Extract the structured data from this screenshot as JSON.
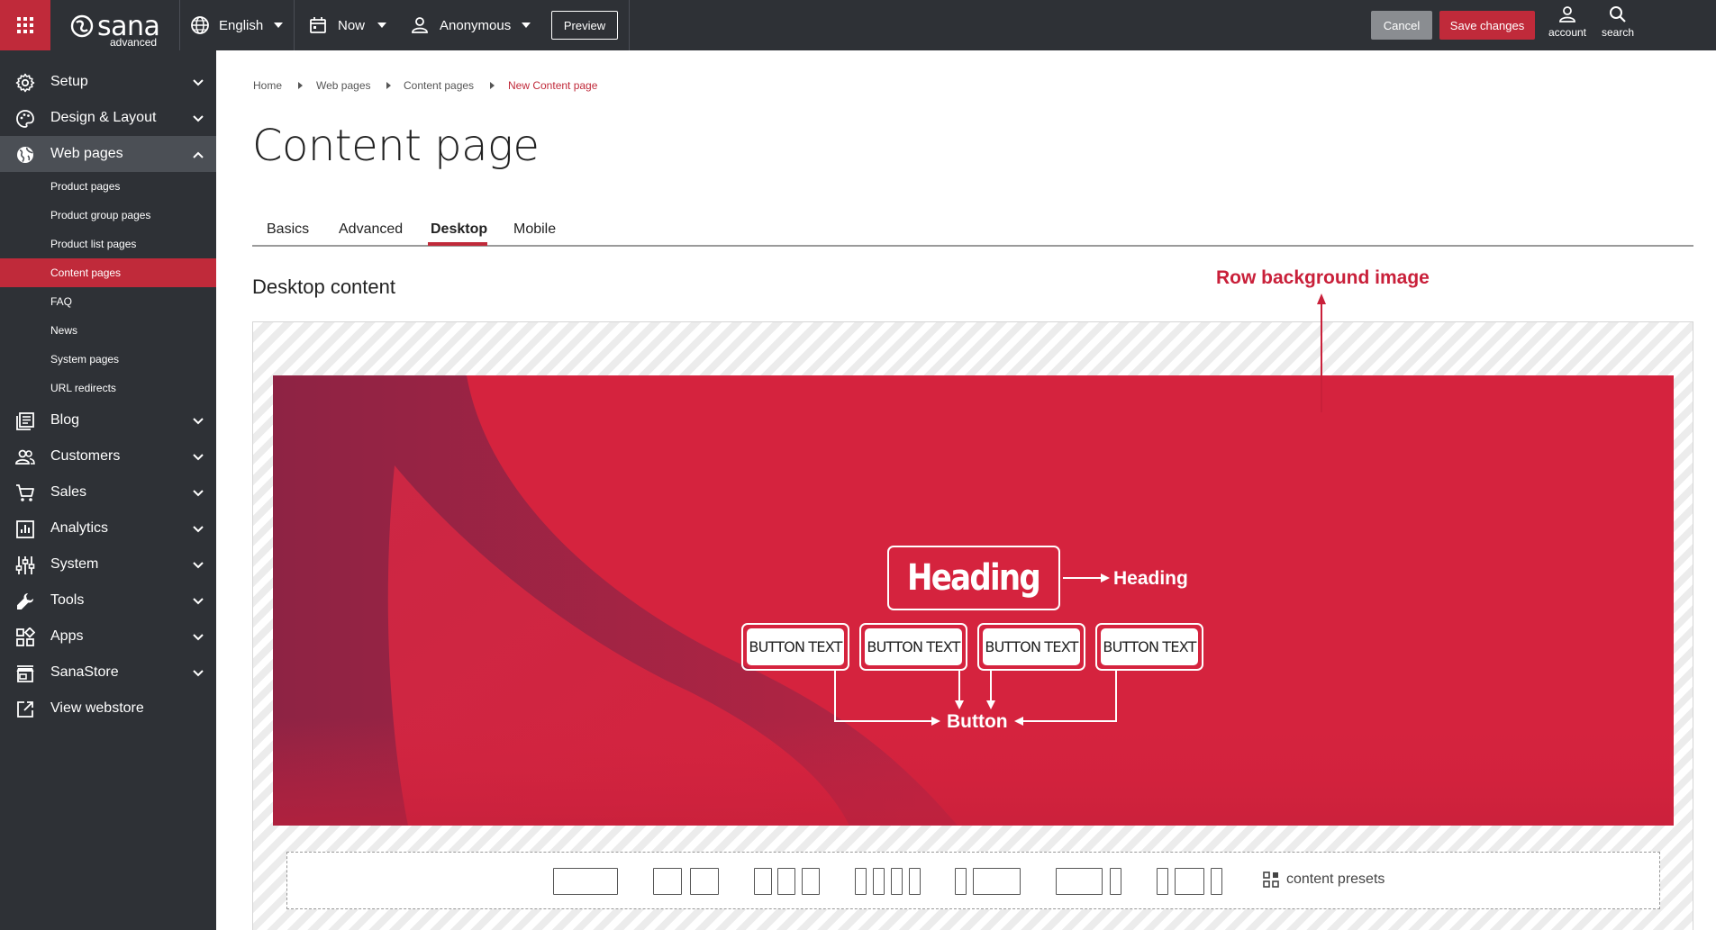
{
  "topbar": {
    "logo_text": "sana",
    "logo_sub": "advanced",
    "language": "English",
    "date": "Now",
    "user": "Anonymous",
    "preview_label": "Preview",
    "cancel_label": "Cancel",
    "save_label": "Save changes",
    "account_label": "account",
    "search_label": "search"
  },
  "sidebar": {
    "items": [
      {
        "label": "Setup",
        "icon": "gear-icon"
      },
      {
        "label": "Design & Layout",
        "icon": "palette-icon"
      },
      {
        "label": "Web pages",
        "icon": "globe-icon",
        "expanded": true
      },
      {
        "label": "Blog",
        "icon": "blog-icon"
      },
      {
        "label": "Customers",
        "icon": "people-icon"
      },
      {
        "label": "Sales",
        "icon": "cart-icon"
      },
      {
        "label": "Analytics",
        "icon": "chart-icon"
      },
      {
        "label": "System",
        "icon": "sliders-icon"
      },
      {
        "label": "Tools",
        "icon": "wrench-icon"
      },
      {
        "label": "Apps",
        "icon": "apps-icon"
      },
      {
        "label": "SanaStore",
        "icon": "store-icon"
      },
      {
        "label": "View webstore",
        "icon": "external-link-icon"
      }
    ],
    "sub_items": [
      {
        "label": "Product pages"
      },
      {
        "label": "Product group pages"
      },
      {
        "label": "Product list pages"
      },
      {
        "label": "Content pages",
        "active": true
      },
      {
        "label": "FAQ"
      },
      {
        "label": "News"
      },
      {
        "label": "System pages"
      },
      {
        "label": "URL redirects"
      }
    ]
  },
  "breadcrumb": [
    "Home",
    "Web pages",
    "Content pages",
    "New Content page"
  ],
  "page_title": "Content page",
  "tabs": [
    {
      "label": "Basics"
    },
    {
      "label": "Advanced"
    },
    {
      "label": "Desktop",
      "active": true
    },
    {
      "label": "Mobile"
    }
  ],
  "section_title": "Desktop content",
  "annotations": {
    "row_background": "Row background image",
    "heading": "Heading",
    "button": "Button"
  },
  "banner": {
    "heading_text": "Heading",
    "buttons": [
      "BUTTON TEXT",
      "BUTTON TEXT",
      "BUTTON TEXT",
      "BUTTON TEXT"
    ]
  },
  "layout_bar": {
    "presets_label": "content presets"
  },
  "colors": {
    "accent": "#c02a3a",
    "topbar": "#2e3136",
    "banner": "#d5233e",
    "annotation": "#c9203a"
  }
}
